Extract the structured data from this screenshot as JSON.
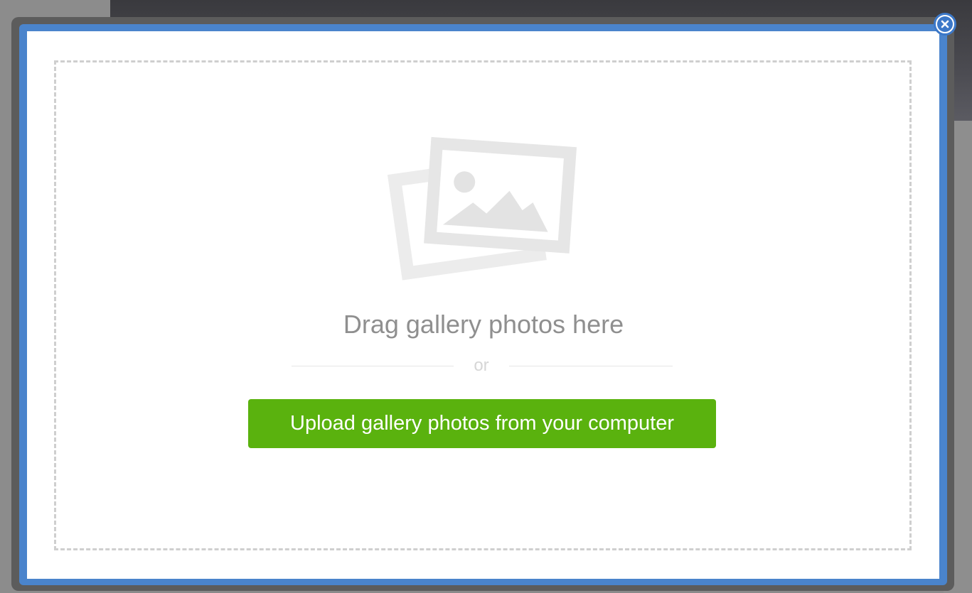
{
  "dropzone": {
    "icon": "photos-icon",
    "drag_text": "Drag gallery photos here",
    "or_text": "or",
    "upload_button_label": "Upload gallery photos from your computer"
  },
  "modal": {
    "close_icon": "close-icon"
  },
  "colors": {
    "modal_border": "#4a84cc",
    "upload_button": "#5ab20e",
    "close_button": "#3c78c8",
    "dropzone_border": "#cfcfcf"
  }
}
